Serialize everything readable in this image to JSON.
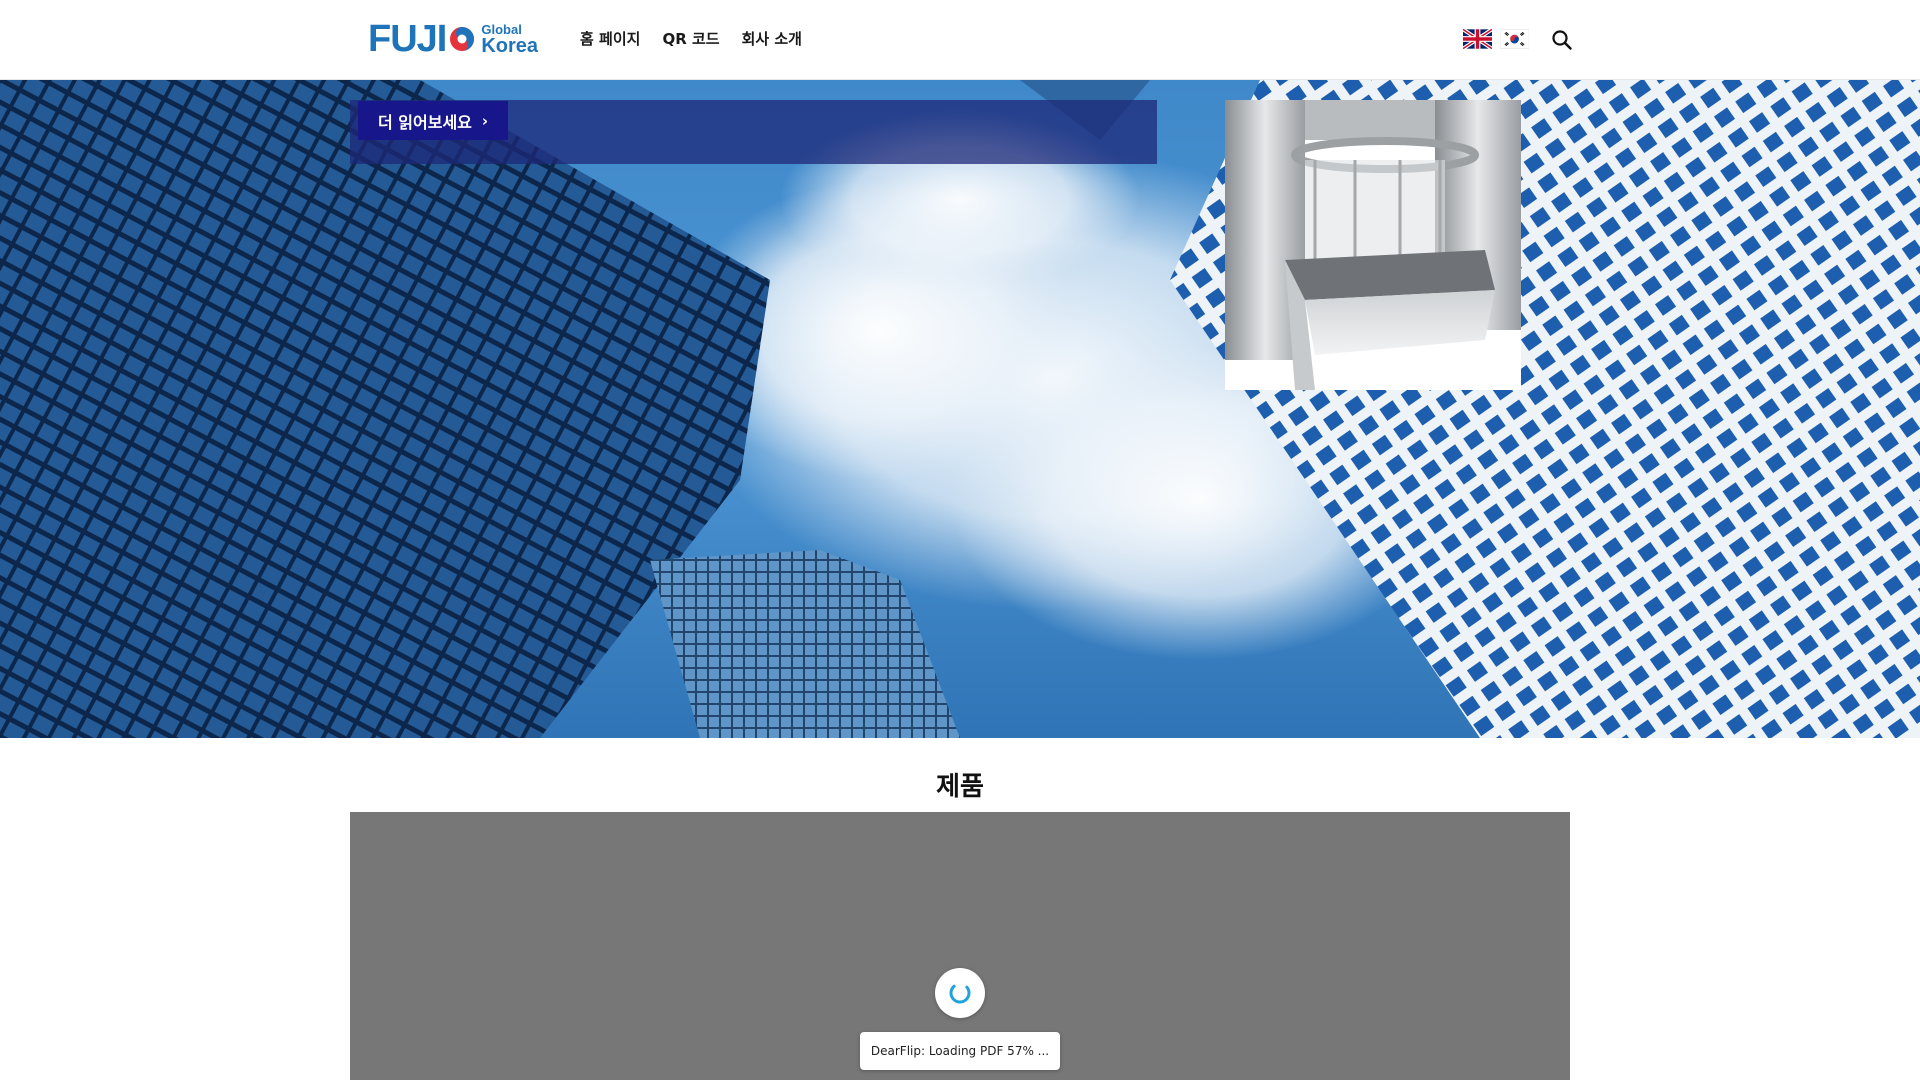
{
  "logo": {
    "brand": "FUJI",
    "sub_line1": "Global",
    "sub_line2": "Korea",
    "icon": "fuji-swirl-logo-mark"
  },
  "nav": {
    "items": [
      {
        "label": "홈 페이지"
      },
      {
        "label": "QR 코드"
      },
      {
        "label": "회사 소개"
      }
    ]
  },
  "header": {
    "flags": [
      {
        "icon": "uk-flag-icon",
        "language": "English"
      },
      {
        "icon": "korea-flag-icon",
        "language": "Korean"
      }
    ],
    "search_icon": "search-icon"
  },
  "hero": {
    "read_more_label": "더 읽어보세요",
    "read_more_icon": "chevron-right-icon",
    "image": "skyscrapers-looking-up-sky",
    "product_image": "elevator-cabin-render"
  },
  "products": {
    "title": "제품",
    "loader_icon": "spinner-icon",
    "loading_text": "DearFlip: Loading PDF 57% ..."
  },
  "colors": {
    "brand_blue": "#1f74b9",
    "brand_red": "#e5323b",
    "button_navy": "#17168a",
    "viewer_gray": "#777777",
    "spinner_cyan": "#1fa3d8"
  }
}
